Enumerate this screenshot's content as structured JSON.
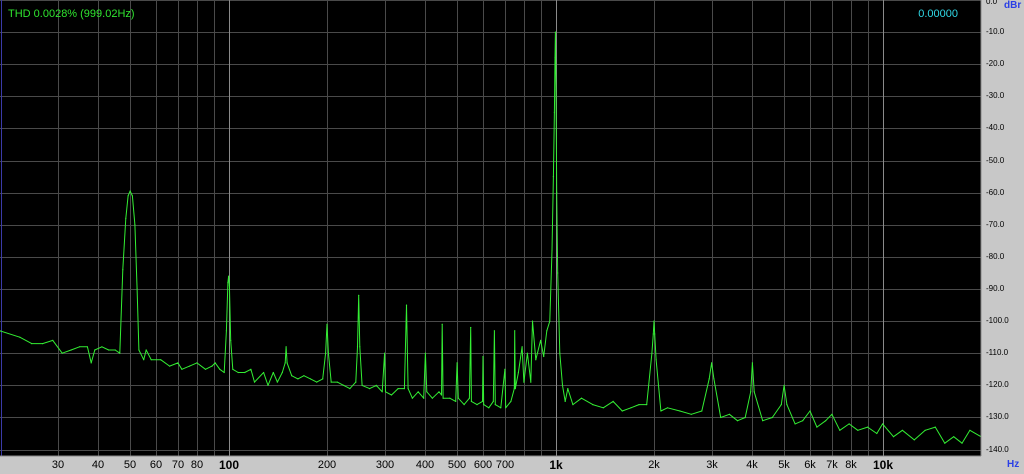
{
  "readouts": {
    "thd": "THD 0.0028% (999.02Hz)",
    "value": "0.00000"
  },
  "colors": {
    "background": "#000000",
    "trace": "#33ee33",
    "grid": "#4a4a4a",
    "major_grid": "#8a8a8a",
    "axis_panel": "#c8c8c8",
    "thd_text": "#2fe52f",
    "value_text": "#2fd8e6",
    "unit_text": "#2a3fe6"
  },
  "chart_data": {
    "type": "line",
    "x_scale": "log",
    "xlim": [
      20,
      20000
    ],
    "ylim": [
      -142,
      0
    ],
    "grid": true,
    "yunit": "dBr",
    "xunit": "Hz",
    "y_ticks": [
      "0.0",
      "-10.0",
      "-20.0",
      "-30.0",
      "-40.0",
      "-50.0",
      "-60.0",
      "-70.0",
      "-80.0",
      "-90.0",
      "-100.0",
      "-110.0",
      "-120.0",
      "-130.0",
      "-140.0"
    ],
    "x_ticks": [
      {
        "label": "30",
        "value": 30,
        "major": false
      },
      {
        "label": "40",
        "value": 40,
        "major": false
      },
      {
        "label": "50",
        "value": 50,
        "major": false
      },
      {
        "label": "60",
        "value": 60,
        "major": false
      },
      {
        "label": "70",
        "value": 70,
        "major": false
      },
      {
        "label": "80",
        "value": 80,
        "major": false
      },
      {
        "label": "100",
        "value": 100,
        "major": true
      },
      {
        "label": "200",
        "value": 200,
        "major": false
      },
      {
        "label": "300",
        "value": 300,
        "major": false
      },
      {
        "label": "400",
        "value": 400,
        "major": false
      },
      {
        "label": "500",
        "value": 500,
        "major": false
      },
      {
        "label": "600",
        "value": 600,
        "major": false
      },
      {
        "label": "700",
        "value": 700,
        "major": false
      },
      {
        "label": "1k",
        "value": 1000,
        "major": true
      },
      {
        "label": "2k",
        "value": 2000,
        "major": false
      },
      {
        "label": "3k",
        "value": 3000,
        "major": false
      },
      {
        "label": "4k",
        "value": 4000,
        "major": false
      },
      {
        "label": "5k",
        "value": 5000,
        "major": false
      },
      {
        "label": "6k",
        "value": 6000,
        "major": false
      },
      {
        "label": "7k",
        "value": 7000,
        "major": false
      },
      {
        "label": "8k",
        "value": 8000,
        "major": false
      },
      {
        "label": "10k",
        "value": 10000,
        "major": true
      }
    ],
    "series": [
      {
        "points": [
          [
            20,
            -103
          ],
          [
            23,
            -105
          ],
          [
            25,
            -107
          ],
          [
            27,
            -107
          ],
          [
            29,
            -106
          ],
          [
            31,
            -110
          ],
          [
            33,
            -109
          ],
          [
            35,
            -108
          ],
          [
            37,
            -108
          ],
          [
            38,
            -113
          ],
          [
            39,
            -109
          ],
          [
            41,
            -108
          ],
          [
            43,
            -109
          ],
          [
            45,
            -109
          ],
          [
            46.5,
            -110
          ],
          [
            47.5,
            -84
          ],
          [
            48.5,
            -68
          ],
          [
            49.3,
            -61
          ],
          [
            50,
            -59.5
          ],
          [
            50.8,
            -61
          ],
          [
            51.7,
            -70
          ],
          [
            52.5,
            -90
          ],
          [
            53.2,
            -109
          ],
          [
            55,
            -112
          ],
          [
            56,
            -109
          ],
          [
            58,
            -112
          ],
          [
            62,
            -112
          ],
          [
            66,
            -114
          ],
          [
            70,
            -113
          ],
          [
            72,
            -115
          ],
          [
            76,
            -114
          ],
          [
            80,
            -113
          ],
          [
            85,
            -115
          ],
          [
            89,
            -114
          ],
          [
            91,
            -113
          ],
          [
            94,
            -115
          ],
          [
            97,
            -116
          ],
          [
            98.5,
            -103
          ],
          [
            99.5,
            -88
          ],
          [
            100,
            -86
          ],
          [
            100.6,
            -89
          ],
          [
            101.5,
            -106
          ],
          [
            103,
            -115
          ],
          [
            107,
            -116
          ],
          [
            112,
            -116
          ],
          [
            117,
            -115
          ],
          [
            120,
            -119
          ],
          [
            128,
            -116
          ],
          [
            132,
            -120
          ],
          [
            137,
            -116
          ],
          [
            141,
            -119
          ],
          [
            146,
            -116
          ],
          [
            149,
            -113
          ],
          [
            150,
            -108
          ],
          [
            151,
            -113
          ],
          [
            156,
            -117
          ],
          [
            163,
            -118
          ],
          [
            170,
            -117
          ],
          [
            178,
            -118
          ],
          [
            186,
            -119
          ],
          [
            194,
            -118
          ],
          [
            198,
            -110
          ],
          [
            200,
            -101
          ],
          [
            202,
            -110
          ],
          [
            206,
            -119
          ],
          [
            215,
            -119
          ],
          [
            225,
            -120
          ],
          [
            235,
            -121
          ],
          [
            245,
            -119
          ],
          [
            248,
            -108
          ],
          [
            250,
            -92
          ],
          [
            252,
            -108
          ],
          [
            256,
            -120
          ],
          [
            270,
            -121
          ],
          [
            283,
            -120
          ],
          [
            295,
            -122
          ],
          [
            300,
            -110
          ],
          [
            302,
            -122
          ],
          [
            315,
            -123
          ],
          [
            330,
            -121
          ],
          [
            345,
            -121
          ],
          [
            350,
            -95
          ],
          [
            354,
            -121
          ],
          [
            365,
            -124
          ],
          [
            380,
            -122
          ],
          [
            395,
            -124
          ],
          [
            400,
            -110
          ],
          [
            404,
            -122
          ],
          [
            420,
            -124
          ],
          [
            440,
            -122
          ],
          [
            448,
            -123
          ],
          [
            450,
            -101
          ],
          [
            453,
            -124
          ],
          [
            475,
            -124
          ],
          [
            495,
            -125
          ],
          [
            500,
            -113
          ],
          [
            504,
            -124
          ],
          [
            525,
            -126
          ],
          [
            545,
            -124
          ],
          [
            550,
            -102
          ],
          [
            553,
            -125
          ],
          [
            575,
            -126
          ],
          [
            598,
            -125
          ],
          [
            600,
            -111
          ],
          [
            603,
            -126
          ],
          [
            625,
            -127
          ],
          [
            645,
            -125
          ],
          [
            650,
            -103
          ],
          [
            654,
            -126
          ],
          [
            680,
            -127
          ],
          [
            700,
            -115
          ],
          [
            704,
            -127
          ],
          [
            730,
            -125
          ],
          [
            748,
            -121
          ],
          [
            750,
            -103
          ],
          [
            753,
            -121
          ],
          [
            770,
            -116
          ],
          [
            790,
            -108
          ],
          [
            800,
            -119
          ],
          [
            820,
            -110
          ],
          [
            840,
            -119
          ],
          [
            850,
            -100
          ],
          [
            870,
            -112
          ],
          [
            900,
            -106
          ],
          [
            920,
            -111
          ],
          [
            940,
            -103
          ],
          [
            960,
            -100
          ],
          [
            975,
            -78
          ],
          [
            985,
            -55
          ],
          [
            992,
            -35
          ],
          [
            996,
            -18
          ],
          [
            999,
            -10
          ],
          [
            1003,
            -28
          ],
          [
            1008,
            -60
          ],
          [
            1015,
            -85
          ],
          [
            1030,
            -110
          ],
          [
            1050,
            -120
          ],
          [
            1070,
            -125
          ],
          [
            1090,
            -121
          ],
          [
            1130,
            -126
          ],
          [
            1200,
            -124
          ],
          [
            1300,
            -126
          ],
          [
            1400,
            -127
          ],
          [
            1500,
            -125
          ],
          [
            1600,
            -128
          ],
          [
            1700,
            -127
          ],
          [
            1800,
            -126
          ],
          [
            1900,
            -126
          ],
          [
            1970,
            -110
          ],
          [
            1990,
            -104
          ],
          [
            2000,
            -100
          ],
          [
            2010,
            -104
          ],
          [
            2030,
            -112
          ],
          [
            2100,
            -128
          ],
          [
            2200,
            -127
          ],
          [
            2400,
            -128
          ],
          [
            2600,
            -129
          ],
          [
            2800,
            -128
          ],
          [
            2950,
            -118
          ],
          [
            3000,
            -113
          ],
          [
            3050,
            -118
          ],
          [
            3200,
            -130
          ],
          [
            3400,
            -129
          ],
          [
            3600,
            -131
          ],
          [
            3800,
            -130
          ],
          [
            3950,
            -122
          ],
          [
            4000,
            -113
          ],
          [
            4050,
            -122
          ],
          [
            4300,
            -131
          ],
          [
            4600,
            -130
          ],
          [
            4900,
            -126
          ],
          [
            5000,
            -120
          ],
          [
            5100,
            -126
          ],
          [
            5400,
            -132
          ],
          [
            5700,
            -131
          ],
          [
            6000,
            -128
          ],
          [
            6300,
            -133
          ],
          [
            6700,
            -131
          ],
          [
            7000,
            -129
          ],
          [
            7400,
            -134
          ],
          [
            7900,
            -132
          ],
          [
            8400,
            -134
          ],
          [
            9000,
            -133
          ],
          [
            9600,
            -135
          ],
          [
            10000,
            -132
          ],
          [
            10800,
            -136
          ],
          [
            11500,
            -134
          ],
          [
            12500,
            -137
          ],
          [
            13500,
            -134
          ],
          [
            14500,
            -133
          ],
          [
            15500,
            -138
          ],
          [
            16500,
            -136
          ],
          [
            17500,
            -138
          ],
          [
            18500,
            -134
          ],
          [
            20000,
            -136
          ]
        ]
      }
    ]
  }
}
